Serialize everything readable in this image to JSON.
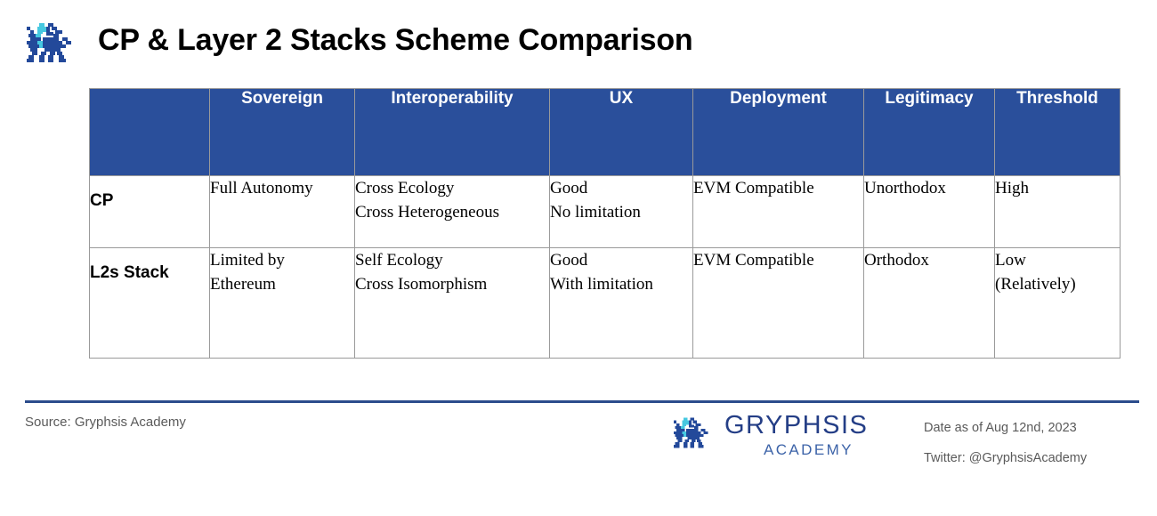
{
  "header": {
    "title": "CP & Layer 2 Stacks Scheme Comparison",
    "logo_icon": "gryphsis-griffin-logo"
  },
  "table": {
    "columns": [
      "",
      "Sovereign",
      "Interoperability",
      "UX",
      "Deployment",
      "Legitimacy",
      "Threshold"
    ],
    "rows": [
      {
        "label": "CP",
        "cells": [
          [
            "Full Autonomy"
          ],
          [
            "Cross Ecology",
            "Cross Heterogeneous"
          ],
          [
            "Good",
            "No limitation"
          ],
          [
            "EVM Compatible"
          ],
          [
            "Unorthodox"
          ],
          [
            "High"
          ]
        ]
      },
      {
        "label": "L2s Stack",
        "cells": [
          [
            "Limited by",
            "Ethereum"
          ],
          [
            "Self Ecology",
            "Cross Isomorphism"
          ],
          [
            "Good",
            "With limitation"
          ],
          [
            "EVM Compatible"
          ],
          [
            "Orthodox"
          ],
          [
            "Low",
            "(Relatively)"
          ]
        ]
      }
    ],
    "header_bg_color": "#2A4F9B",
    "border_color": "#9A9A9A"
  },
  "footer": {
    "source": "Source: Gryphsis Academy",
    "brand_name": "GRYPHSIS",
    "brand_sub": "ACADEMY",
    "date_line": "Date as of Aug 12nd, 2023",
    "twitter_line": "Twitter: @GryphsisAcademy",
    "rule_color": "#2B4C8C",
    "brand_color": "#243E86",
    "brand_sub_color": "#3C63A8",
    "accent_color": "#35C6E0"
  }
}
